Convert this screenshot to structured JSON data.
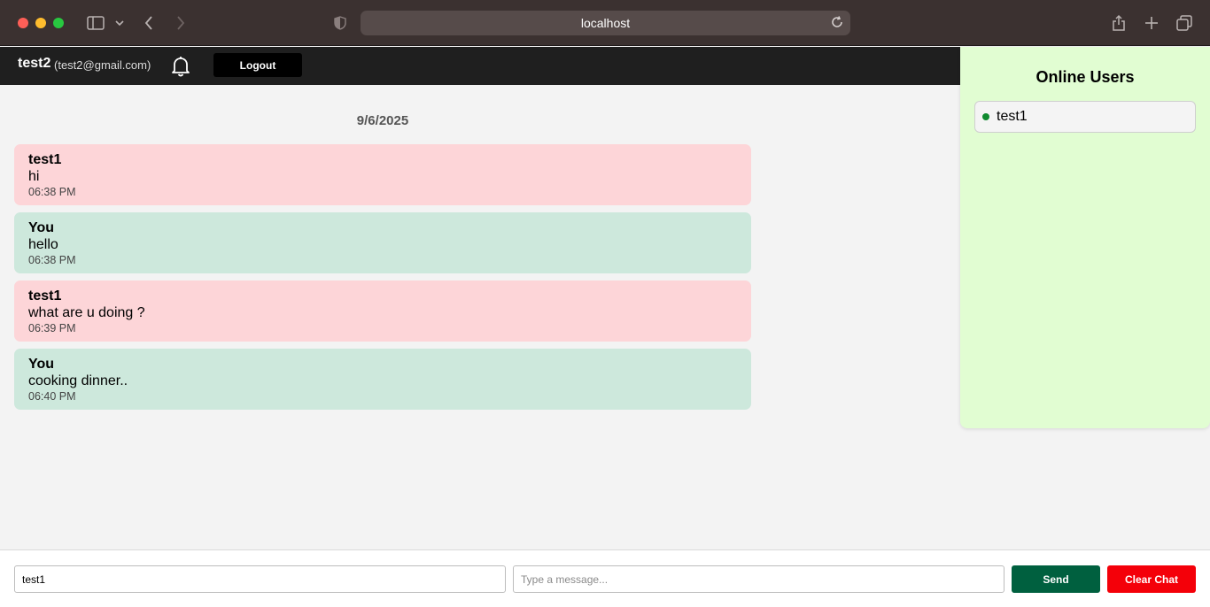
{
  "browser": {
    "url": "localhost"
  },
  "header": {
    "user_name": "test2",
    "user_email": "(test2@gmail.com)",
    "logout_label": "Logout"
  },
  "chat": {
    "date": "9/6/2025",
    "messages": [
      {
        "sender": "test1",
        "text": "hi",
        "time": "06:38 PM",
        "side": "other"
      },
      {
        "sender": "You",
        "text": "hello",
        "time": "06:38 PM",
        "side": "me"
      },
      {
        "sender": "test1",
        "text": "what are u doing ?",
        "time": "06:39 PM",
        "side": "other"
      },
      {
        "sender": "You",
        "text": "cooking dinner..",
        "time": "06:40 PM",
        "side": "me"
      }
    ]
  },
  "online": {
    "title": "Online Users",
    "users": [
      {
        "name": "test1",
        "status_color": "#0f8a2f"
      }
    ]
  },
  "composer": {
    "recipient_value": "test1",
    "message_placeholder": "Type a message...",
    "send_label": "Send",
    "clear_label": "Clear Chat"
  },
  "colors": {
    "other_bubble": "#fdd5d8",
    "my_bubble": "#cde8dc",
    "online_panel": "#e1fdd2",
    "send_button": "#00603f",
    "clear_button": "#f40009"
  }
}
